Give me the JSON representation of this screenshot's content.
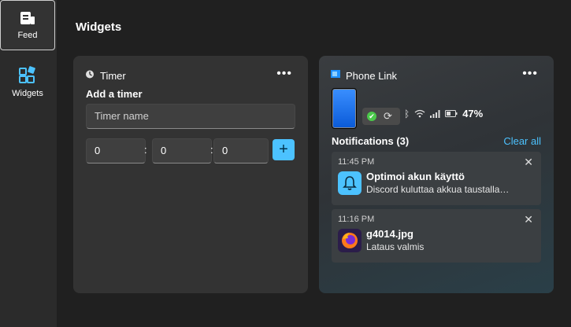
{
  "rail": {
    "items": [
      {
        "label": "Feed",
        "icon": "feed-icon"
      },
      {
        "label": "Widgets",
        "icon": "widgets-icon"
      }
    ]
  },
  "page": {
    "title": "Widgets"
  },
  "timer": {
    "title": "Timer",
    "heading": "Add a timer",
    "name_placeholder": "Timer name",
    "hours": "0",
    "minutes": "0",
    "seconds": "0",
    "colon": ":",
    "more": "•••",
    "add": "+"
  },
  "phone_link": {
    "title": "Phone Link",
    "more": "•••",
    "battery": "47%",
    "notifications_title": "Notifications (3)",
    "clear_all": "Clear all",
    "notifications": [
      {
        "time": "11:45 PM",
        "title": "Optimoi akun käyttö",
        "body": "Discord kuluttaa akkua taustalla…",
        "icon": "bell-icon"
      },
      {
        "time": "11:16 PM",
        "title": "g4014.jpg",
        "body": "Lataus valmis",
        "icon": "firefox-icon"
      }
    ]
  },
  "colors": {
    "accent": "#4cc2ff",
    "background": "#202020",
    "card": "#333333",
    "success": "#4bc84b"
  }
}
